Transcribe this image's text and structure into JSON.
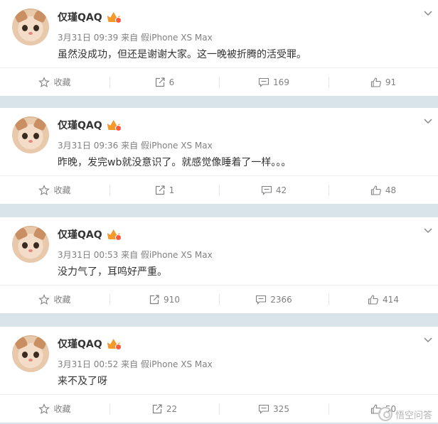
{
  "posts": [
    {
      "username": "仅瑾QAQ",
      "meta": "3月31日 09:39 来自 假iPhone XS Max",
      "text": "虽然没成功，但还是谢谢大家。这一晚被折腾的活受罪。",
      "favorite_label": "收藏",
      "reposts": "6",
      "comments": "169",
      "likes": "91"
    },
    {
      "username": "仅瑾QAQ",
      "meta": "3月31日 09:36 来自 假iPhone XS Max",
      "text": "昨晚，发完wb就没意识了。就感觉像睡着了一样。。。",
      "favorite_label": "收藏",
      "reposts": "1",
      "comments": "42",
      "likes": "48"
    },
    {
      "username": "仅瑾QAQ",
      "meta": "3月31日 00:53 来自 假iPhone XS Max",
      "text": "没力气了，耳鸣好严重。",
      "favorite_label": "收藏",
      "reposts": "910",
      "comments": "2366",
      "likes": "414"
    },
    {
      "username": "仅瑾QAQ",
      "meta": "3月31日 00:52 来自 假iPhone XS Max",
      "text": "来不及了呀",
      "favorite_label": "收藏",
      "reposts": "22",
      "comments": "325",
      "likes": "50"
    }
  ],
  "watermark": "悟空问答",
  "icons": [
    "chevron-down-icon",
    "star-icon",
    "repost-icon",
    "comment-icon",
    "like-icon"
  ],
  "colors": {
    "background": "#d9e3ea",
    "card": "#ffffff",
    "vip_badge": "#f39a2a"
  }
}
